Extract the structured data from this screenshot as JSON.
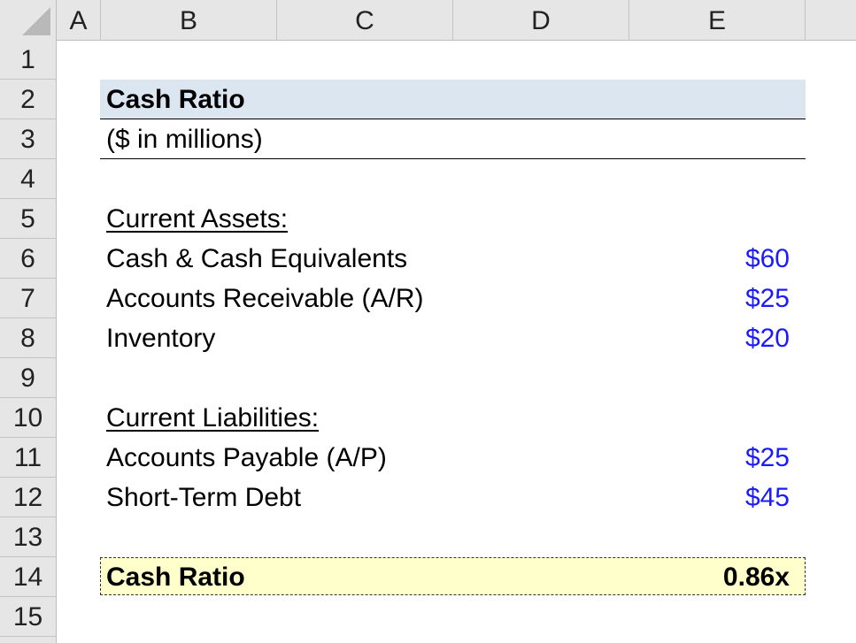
{
  "columns": [
    "A",
    "B",
    "C",
    "D",
    "E"
  ],
  "rows": [
    "1",
    "2",
    "3",
    "4",
    "5",
    "6",
    "7",
    "8",
    "9",
    "10",
    "11",
    "12",
    "13",
    "14",
    "15"
  ],
  "title": "Cash Ratio",
  "subtitle": "($ in millions)",
  "current_assets": {
    "header": "Current Assets:",
    "items": [
      {
        "label": "Cash & Cash Equivalents",
        "value": "$60"
      },
      {
        "label": "Accounts Receivable (A/R)",
        "value": "$25"
      },
      {
        "label": "Inventory",
        "value": "$20"
      }
    ]
  },
  "current_liabilities": {
    "header": "Current Liabilities:",
    "items": [
      {
        "label": "Accounts Payable (A/P)",
        "value": "$25"
      },
      {
        "label": "Short-Term Debt",
        "value": "$45"
      }
    ]
  },
  "result": {
    "label": "Cash Ratio",
    "value": "0.86x"
  },
  "colors": {
    "input_blue": "#1a1aff",
    "title_fill": "#dce6f1",
    "result_fill": "#ffffcc"
  }
}
